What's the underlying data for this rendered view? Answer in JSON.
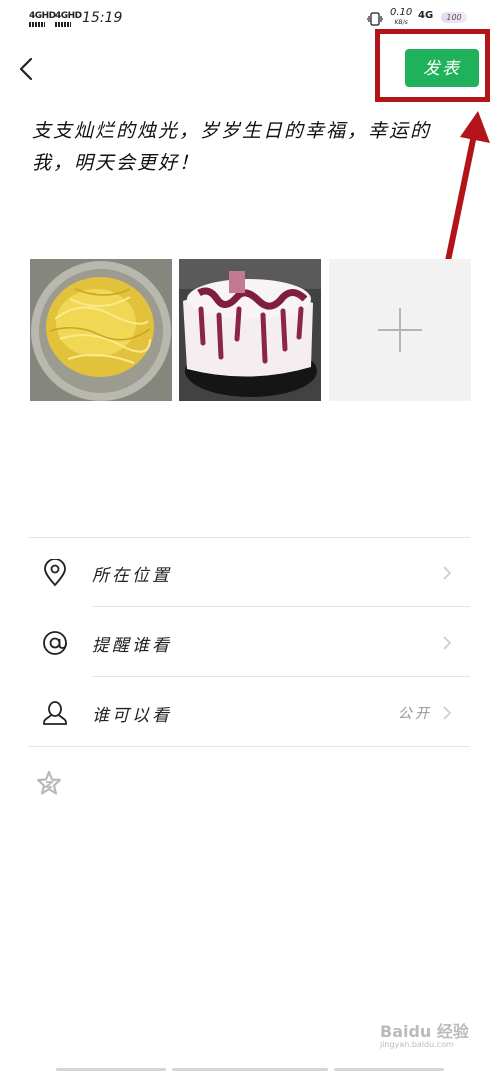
{
  "status_bar": {
    "sim1": "4GHD",
    "sim2": "4GHD",
    "time": "15:19",
    "speed_value": "0.10",
    "speed_unit": "KB/s",
    "network": "4G",
    "battery": "100"
  },
  "header": {
    "back_icon": "chevron-left-icon",
    "publish_label": "发表",
    "publish_color": "#1fb25a",
    "highlight_color": "#b3141a"
  },
  "post": {
    "text": "支支灿烂的烛光，岁岁生日的幸福，幸运的我，明天会更好！"
  },
  "photos": [
    {
      "name": "photo-noodles"
    },
    {
      "name": "photo-cake"
    }
  ],
  "options": [
    {
      "icon": "location-pin-icon",
      "label": "所在位置",
      "value": ""
    },
    {
      "icon": "at-sign-icon",
      "label": "提醒谁看",
      "value": ""
    },
    {
      "icon": "person-icon",
      "label": "谁可以看",
      "value": "公开"
    }
  ],
  "watermark": {
    "brand": "Baidu 经验",
    "url": "jingyan.baidu.com"
  }
}
